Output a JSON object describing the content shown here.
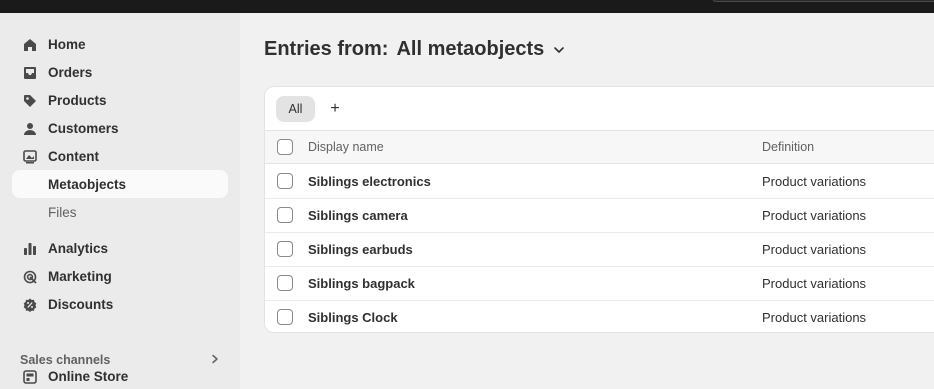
{
  "sidebar": {
    "items": [
      {
        "label": "Home",
        "icon": "home-icon"
      },
      {
        "label": "Orders",
        "icon": "inbox-icon"
      },
      {
        "label": "Products",
        "icon": "tag-icon"
      },
      {
        "label": "Customers",
        "icon": "person-icon"
      },
      {
        "label": "Content",
        "icon": "image-icon"
      },
      {
        "label": "Metaobjects",
        "active": true,
        "sub": true
      },
      {
        "label": "Files",
        "sub": true
      },
      {
        "label": "Analytics",
        "icon": "bar-chart-icon"
      },
      {
        "label": "Marketing",
        "icon": "target-icon"
      },
      {
        "label": "Discounts",
        "icon": "discount-icon"
      }
    ],
    "sales_channels_title": "Sales channels",
    "online_store_label": "Online Store"
  },
  "header": {
    "title_prefix": "Entries from:",
    "title_value": "All metaobjects"
  },
  "tabs": {
    "all_label": "All",
    "add_label": "+"
  },
  "table": {
    "columns": [
      "Display name",
      "Definition"
    ],
    "rows": [
      {
        "name": "Siblings electronics",
        "definition": "Product variations"
      },
      {
        "name": "Siblings camera",
        "definition": "Product variations"
      },
      {
        "name": "Siblings earbuds",
        "definition": "Product variations"
      },
      {
        "name": "Siblings bagpack",
        "definition": "Product variations"
      },
      {
        "name": "Siblings Clock",
        "definition": "Product variations"
      }
    ]
  }
}
